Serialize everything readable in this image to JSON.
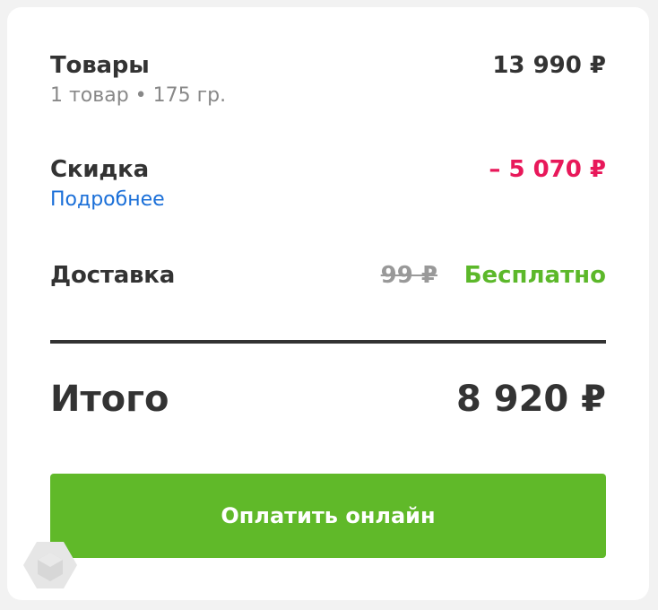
{
  "summary": {
    "goods": {
      "label": "Товары",
      "meta": "1 товар • 175 гр.",
      "price": "13 990 ₽"
    },
    "discount": {
      "label": "Скидка",
      "details_link": "Подробнее",
      "amount": "– 5 070 ₽"
    },
    "delivery": {
      "label": "Доставка",
      "old_price": "99 ₽",
      "price": "Бесплатно"
    },
    "total": {
      "label": "Итого",
      "amount": "8 920 ₽"
    },
    "pay_button_label": "Оплатить онлайн"
  },
  "colors": {
    "discount": "#e8185a",
    "free": "#5cb82a",
    "button": "#60b929",
    "link": "#1a6fd8"
  }
}
